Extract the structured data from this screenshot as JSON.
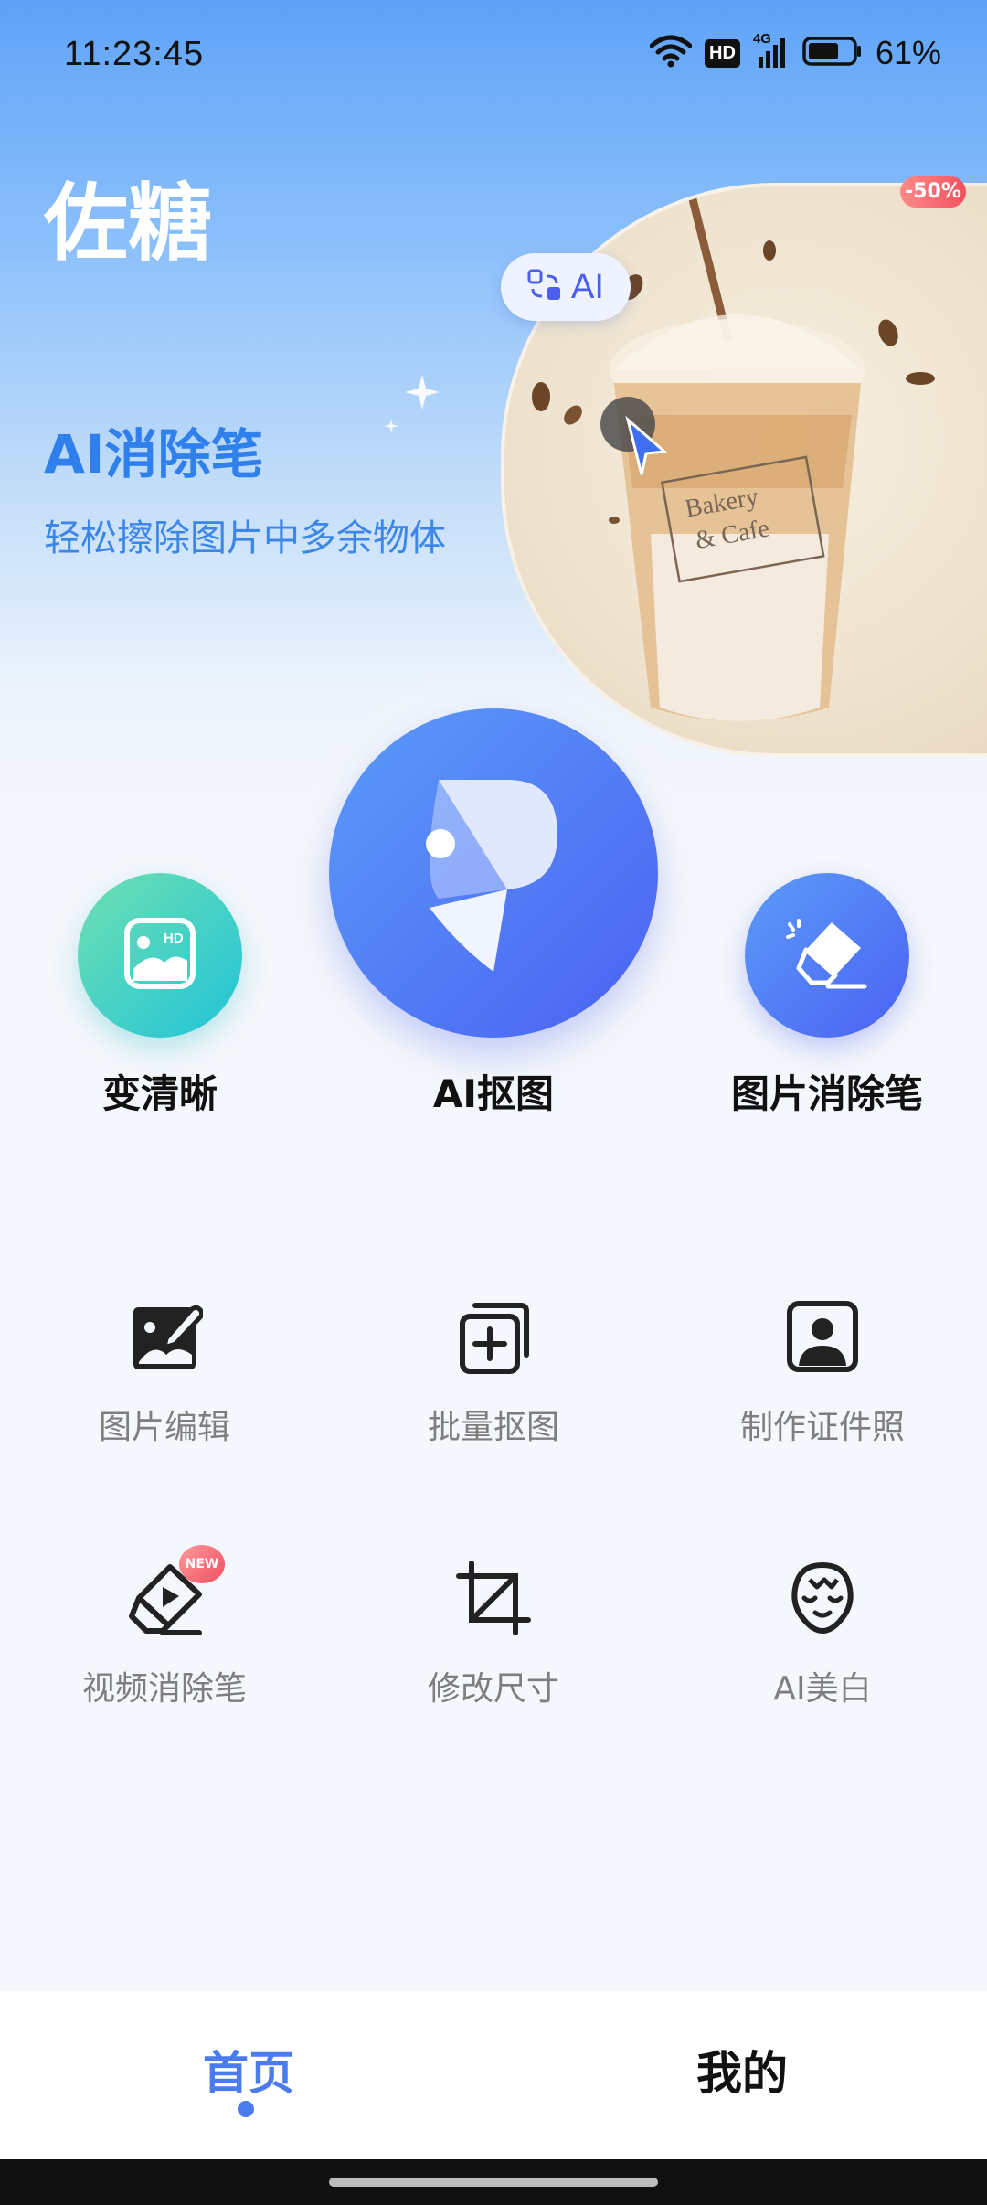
{
  "status_bar": {
    "time": "11:23:45",
    "network": "4G",
    "hd_label": "HD",
    "battery_percent": "61%",
    "icons": [
      "wifi-icon",
      "hd-icon",
      "signal-icon",
      "battery-icon"
    ]
  },
  "header": {
    "app_title": "佐糖"
  },
  "banner": {
    "feature_title": "AI消除笔",
    "feature_subtitle": "轻松擦除图片中多余物体",
    "discount_badge": "-50%",
    "ai_chip_label": "AI",
    "image_cup_text_line1": "Bakery",
    "image_cup_text_line2": "& Cafe"
  },
  "main_tools": [
    {
      "label": "变清晰",
      "icon": "hd-image-icon"
    },
    {
      "label": "AI抠图",
      "icon": "app-logo-icon"
    },
    {
      "label": "图片消除笔",
      "icon": "eraser-icon"
    }
  ],
  "grid_tools": [
    {
      "label": "图片编辑",
      "icon": "image-edit-icon"
    },
    {
      "label": "批量抠图",
      "icon": "batch-cutout-icon"
    },
    {
      "label": "制作证件照",
      "icon": "id-photo-icon"
    },
    {
      "label": "视频消除笔",
      "icon": "video-eraser-icon",
      "badge": "NEW"
    },
    {
      "label": "修改尺寸",
      "icon": "crop-icon"
    },
    {
      "label": "AI美白",
      "icon": "face-beauty-icon"
    }
  ],
  "bottom_nav": {
    "tabs": [
      {
        "label": "首页",
        "active": true
      },
      {
        "label": "我的",
        "active": false
      }
    ]
  },
  "colors": {
    "accent": "#4a7cf0",
    "title_blue": "#2f80ed",
    "gradient_green_start": "#6ee0b0",
    "gradient_green_end": "#22c4d9",
    "gradient_blue_start": "#5b9cf9",
    "gradient_blue_end": "#4b61f2"
  }
}
